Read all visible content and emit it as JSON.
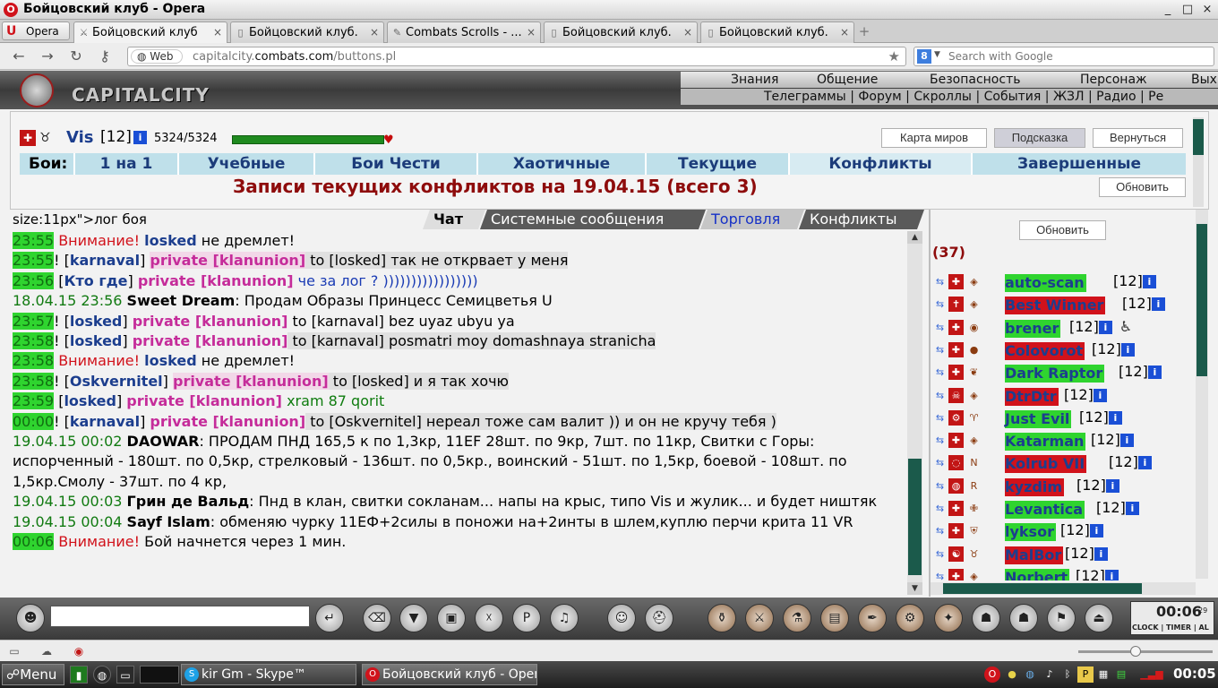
{
  "window": {
    "title": "Бойцовский клуб - Opera",
    "min": "_",
    "max": "□",
    "close": "×"
  },
  "browser": {
    "opera_label": "Opera",
    "tabs": [
      {
        "title": "Бойцовский клуб",
        "icon": "swords-icon",
        "active": true,
        "close": "×"
      },
      {
        "title": "Бойцовский клуб.",
        "icon": "page-icon",
        "active": false,
        "close": "×"
      },
      {
        "title": "Combats Scrolls - ...",
        "icon": "scroll-icon",
        "active": false,
        "close": "×"
      },
      {
        "title": "Бойцовский клуб.",
        "icon": "page-icon",
        "active": false,
        "close": "×"
      },
      {
        "title": "Бойцовский клуб.",
        "icon": "page-icon",
        "active": false,
        "close": "×"
      }
    ],
    "new_tab": "+",
    "address": {
      "badge": "Web",
      "url_prefix": "capitalcity.",
      "url_domain": "combats.com",
      "url_path": "/buttons.pl"
    },
    "search_placeholder": "Search with Google"
  },
  "game": {
    "logo_text": "CAPITALCITY",
    "menu_top": [
      "Знания",
      "Общение",
      "Безопасность",
      "Персонаж",
      "Вых"
    ],
    "menu_sub": [
      "Телеграммы",
      "Форум",
      "Скроллы",
      "События",
      "ЖЗЛ",
      "Радио",
      "Ре"
    ],
    "menu_sub_sep": "|",
    "character": {
      "name": "Vis",
      "level": "[12]",
      "hp": "5324/5324",
      "hp_fraction": 1.0,
      "info": "i"
    },
    "buttons": {
      "world_map": "Карта миров",
      "hint": "Подсказка",
      "back": "Вернуться",
      "refresh": "Обновить"
    },
    "battles_label": "Бои:",
    "battle_tabs": [
      "1 на 1",
      "Учебные",
      "Бои Чести",
      "Хаотичные",
      "Текущие",
      "Конфликты",
      "Завершенные"
    ],
    "page_title": "Записи текущих конфликтов на 19.04.15 (всего 3)",
    "log_word": "size:11px\">лог боя",
    "chat_tabs": [
      "Чат",
      "Системные сообщения",
      "Торговля",
      "Конфликты"
    ],
    "chat": [
      {
        "time": "23:55",
        "warn": "Внимание!",
        "nick": "losked",
        "text": " не дремлет!"
      },
      {
        "time": "23:55",
        "pre": "! [",
        "nick": "karnaval",
        "mid": "] ",
        "priv": "private [klanunion]",
        "text": " to [losked] так не открвает у меня"
      },
      {
        "time": "23:56",
        "pre": " [",
        "nick": "Кто где",
        "mid": "] ",
        "priv": "private [klanunion]",
        "text": " че за лог ? )))))))))))))))))"
      },
      {
        "date": "18.04.15 23:56",
        "nick": "Sweet Dream",
        "text": ": Продам Образы Принцесс Семицветья U"
      },
      {
        "time": "23:57",
        "pre": "! [",
        "nick": "losked",
        "mid": "] ",
        "priv": "private [klanunion]",
        "text": " to [karnaval] bez uyaz ubyu ya"
      },
      {
        "time": "23:58",
        "pre": "! [",
        "nick": "losked",
        "mid": "] ",
        "priv": "private [klanunion]",
        "text": " to [karnaval] posmatri moy domashnaya stranicha"
      },
      {
        "time": "23:58",
        "warn": "Внимание!",
        "nick": "losked",
        "text": " не дремлет!"
      },
      {
        "time": "23:58",
        "pre": "! [",
        "nick": "Oskvernitel",
        "mid": "] ",
        "priv": "private [klanunion]",
        "text": " to [losked] и я так хочю"
      },
      {
        "time": "23:59",
        "pre": " [",
        "nick": "losked",
        "mid": "] ",
        "priv": "private [klanunion]",
        "text": " xram 87 qorit"
      },
      {
        "time": "00:00",
        "pre": "! [",
        "nick": "karnaval",
        "mid": "] ",
        "priv": "private [klanunion]",
        "text": " to [Oskvernitel] нереал тоже сам валит )) и он не кручу тебя )"
      },
      {
        "date": "19.04.15 00:02",
        "nick": "DAOWAR",
        "text": ": ПРОДАМ ПНД 165,5 к по 1,3кр, 11EF 28шт. по 9кр, 7шт. по 11кр, Свитки с Горы: испорченный - 180шт. по 0,5кр, стрелковый - 136шт. по 0,5кр., воинский - 51шт. по 1,5кр, боевой - 108шт. по 1,5кр.Смолу - 37шт. по 4 кр,"
      },
      {
        "date": "19.04.15 00:03",
        "nick": "Грин де Вальд",
        "text": ": Пнд в клан, свитки сокланам... напы на крыс, типо Vis и жулик... и будет ништяк"
      },
      {
        "date": "19.04.15 00:04",
        "nick": "Sayf Islam",
        "text": ": обменяю чурку 11ЕФ+2силы в поножи на+2инты в шлем,куплю перчи крита 11 VR"
      },
      {
        "time": "00:06",
        "warn": "Внимание!",
        "text": " Бой начнется через 1 мин."
      }
    ],
    "online_count": "(37)",
    "users": [
      {
        "name": "auto-scan",
        "level": "[12]",
        "bg": "green"
      },
      {
        "name": "Best Winner",
        "level": "[12]",
        "bg": "red"
      },
      {
        "name": "brener",
        "level": "[12]",
        "bg": "green"
      },
      {
        "name": "Colovorot",
        "level": "[12]",
        "bg": "red"
      },
      {
        "name": "Dark Raptor",
        "level": "[12]",
        "bg": "green"
      },
      {
        "name": "DtrDtr",
        "level": "[12]",
        "bg": "red"
      },
      {
        "name": "Just Evil",
        "level": "[12]",
        "bg": "green"
      },
      {
        "name": "Katarman",
        "level": "[12]",
        "bg": "green"
      },
      {
        "name": "Kolrub VII",
        "level": "[12]",
        "bg": "red"
      },
      {
        "name": "kyzdim",
        "level": "[12]",
        "bg": "red"
      },
      {
        "name": "Levantica",
        "level": "[12]",
        "bg": "green"
      },
      {
        "name": "lyksor",
        "level": "[12]",
        "bg": "green"
      },
      {
        "name": "MalBor",
        "level": "[12]",
        "bg": "red"
      },
      {
        "name": "Norbert",
        "level": "[12]",
        "bg": "green"
      }
    ],
    "clock": {
      "time": "00:06",
      "seconds": "29",
      "labels": "CLOCK | TIMER | AL"
    }
  },
  "taskbar": {
    "menu": "Menu",
    "tasks": [
      {
        "title": "kir Gm - Skype™",
        "icon": "skype-icon"
      },
      {
        "title": "Бойцовский клуб - Opera",
        "icon": "opera-icon"
      }
    ],
    "clock": "00:05"
  },
  "colors": {
    "accent_red": "#8e0c0c",
    "nick_blue": "#1c3e8e",
    "private_pink": "#c52c9a",
    "time_green": "#2fd42f",
    "scroll_green": "#1b5a4b"
  }
}
